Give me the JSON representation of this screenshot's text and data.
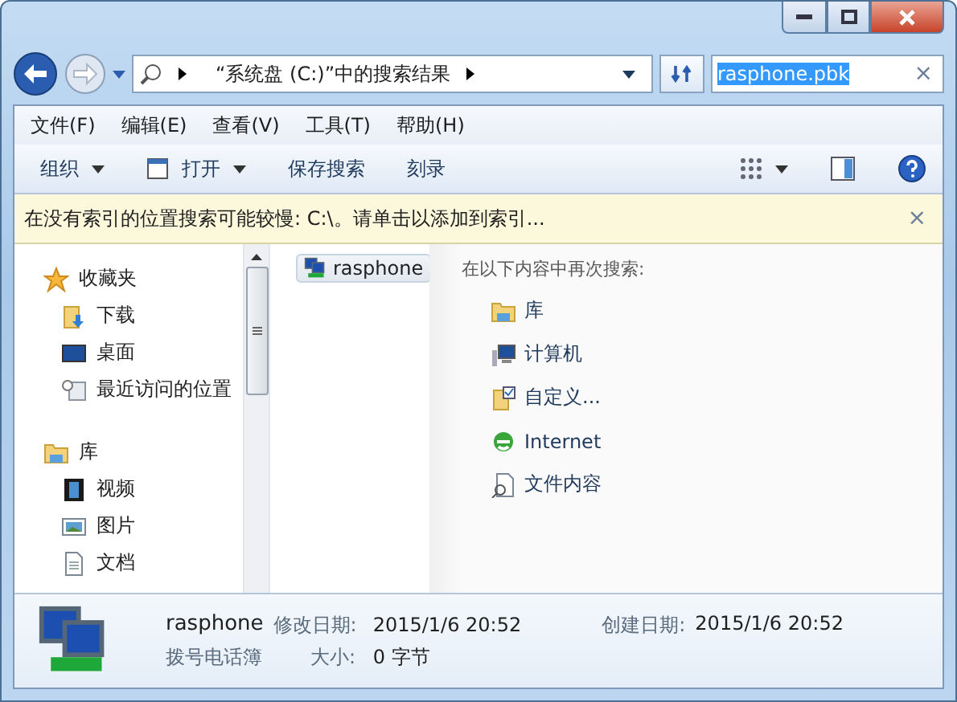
{
  "address": {
    "breadcrumb": "“系统盘 (C:)”中的搜索结果"
  },
  "search": {
    "value": "rasphone.pbk",
    "selected": true,
    "clear": "×"
  },
  "menu": [
    "文件(F)",
    "编辑(E)",
    "查看(V)",
    "工具(T)",
    "帮助(H)"
  ],
  "toolbar": [
    {
      "label": "组织",
      "icon": false,
      "dropdown": true
    },
    {
      "label": "打开",
      "icon": true,
      "dropdown": true
    },
    {
      "label": "保存搜索",
      "icon": false,
      "dropdown": false
    },
    {
      "label": "刻录",
      "icon": false,
      "dropdown": false
    }
  ],
  "infobar": {
    "message": "在没有索引的位置搜索可能较慢: C:\\。请单击以添加到索引...",
    "dismiss": "×"
  },
  "nav": [
    {
      "label": "收藏夹",
      "kind": "star",
      "children": [
        {
          "label": "下载",
          "kind": "download"
        },
        {
          "label": "桌面",
          "kind": "desktop"
        },
        {
          "label": "最近访问的位置",
          "kind": "recent"
        }
      ]
    },
    {
      "label": "库",
      "kind": "library",
      "children": [
        {
          "label": "视频",
          "kind": "video"
        },
        {
          "label": "图片",
          "kind": "picture"
        },
        {
          "label": "文档",
          "kind": "document"
        }
      ]
    }
  ],
  "results": [
    {
      "name": "rasphone",
      "selected": true
    }
  ],
  "search_again": {
    "heading": "在以下内容中再次搜索:",
    "items": [
      {
        "label": "库",
        "kind": "library"
      },
      {
        "label": "计算机",
        "kind": "computer"
      },
      {
        "label": "自定义...",
        "kind": "custom"
      },
      {
        "label": "Internet",
        "kind": "internet"
      },
      {
        "label": "文件内容",
        "kind": "content"
      }
    ]
  },
  "details": {
    "name": "rasphone",
    "type": "拨号电话簿",
    "modified_label": "修改日期:",
    "modified": "2015/1/6 20:52",
    "size_label": "大小:",
    "size": "0 字节",
    "created_label": "创建日期:",
    "created": "2015/1/6 20:52"
  }
}
